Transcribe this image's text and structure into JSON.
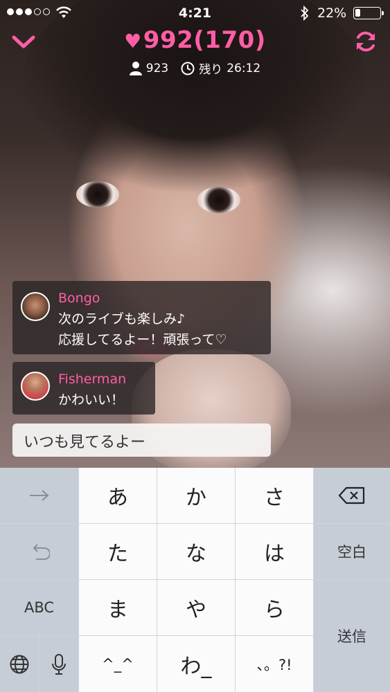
{
  "status": {
    "time": "4:21",
    "battery": "22%",
    "battery_level": 0.22
  },
  "live": {
    "likes": "992",
    "likes_sub": "(170)",
    "viewers": "923",
    "remaining_label": "残り",
    "remaining_time": "26:12"
  },
  "comments": [
    {
      "user": "Bongo",
      "lines": [
        "次のライブも楽しみ♪",
        "応援してるよー！頑張って♡"
      ]
    },
    {
      "user": "Fisherman",
      "lines": [
        "かわいい！"
      ]
    }
  ],
  "input": {
    "value": "いつも見てるよー"
  },
  "keyboard": {
    "rows": [
      [
        "→",
        "あ",
        "か",
        "さ",
        "⌫"
      ],
      [
        "↺",
        "た",
        "な",
        "は",
        "空白"
      ],
      [
        "ABC",
        "ま",
        "や",
        "ら",
        "送信"
      ],
      [
        "🌐",
        "🎤",
        "^^",
        "わ_",
        "、。?!"
      ]
    ],
    "space_label": "空白",
    "send_label": "送信",
    "abc_label": "ABC",
    "keys": {
      "a": "あ",
      "ka": "か",
      "sa": "さ",
      "ta": "た",
      "na": "な",
      "ha": "は",
      "ma": "ま",
      "ya": "や",
      "ra": "ら",
      "emoticon": "^_^",
      "wa": "わ_",
      "punct": "、。?!"
    }
  },
  "colors": {
    "accent": "#ff5ea6",
    "keyboard_bg": "#cfd5dd",
    "key_white": "#fbfbfc",
    "key_gray": "#c6cdd6"
  },
  "icons": [
    "chevron-down-icon",
    "refresh-icon",
    "heart-icon",
    "person-icon",
    "clock-icon",
    "wifi-icon",
    "bluetooth-icon",
    "battery-icon",
    "backspace-icon",
    "undo-icon",
    "globe-icon",
    "microphone-icon",
    "arrow-right-icon"
  ]
}
